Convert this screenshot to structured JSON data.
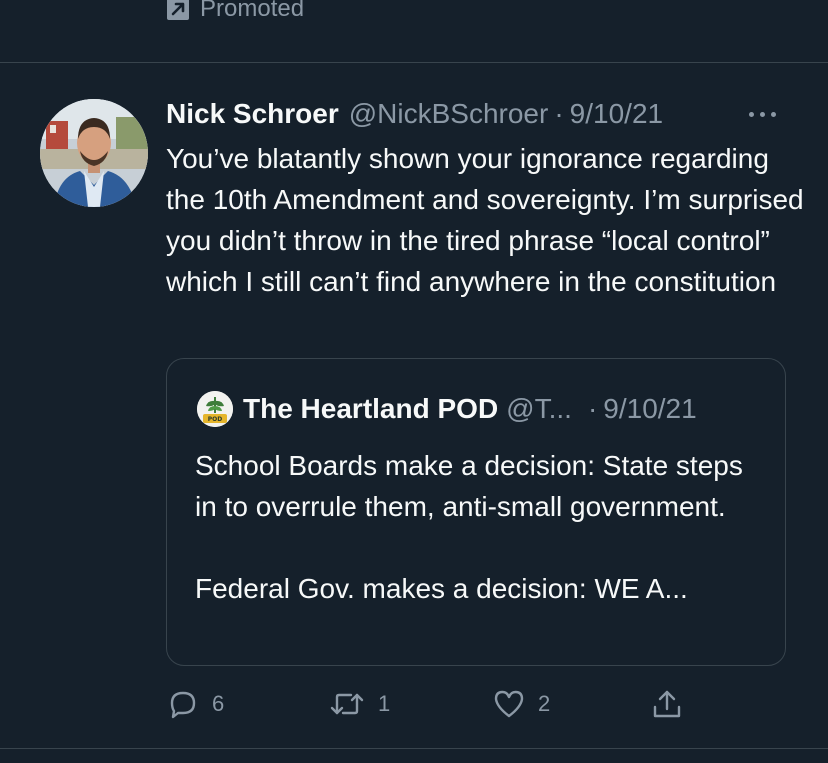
{
  "promoted": {
    "label": "Promoted",
    "icon": "promoted-arrow-icon"
  },
  "tweet": {
    "author_name": "Nick Schroer",
    "author_handle": "@NickBSchroer",
    "separator": "·",
    "date": "9/10/21",
    "text": "You’ve blatantly shown your ignorance regarding the 10th Amendment and sovereignty. I’m surprised you didn’t throw in the tired phrase “local control” which I still can’t find anywhere in the constitution",
    "more_icon": "more-horizontal-icon"
  },
  "quote": {
    "author_name": "The Heartland POD",
    "author_handle": "@T...",
    "separator": "·",
    "date": "9/10/21",
    "logo_text": "HEARTLAND POD",
    "text_line1": "School Boards make a decision: State steps in to overrule them, anti-small government.",
    "text_line2": "Federal Gov. makes a decision: WE A..."
  },
  "actions": {
    "reply_count": "6",
    "retweet_count": "1",
    "like_count": "2",
    "icons": [
      "reply-icon",
      "retweet-icon",
      "like-icon",
      "share-icon"
    ]
  },
  "colors": {
    "background": "#15202b",
    "text_primary": "#f7f9f9",
    "text_secondary": "#8b98a5",
    "border": "#38444d"
  }
}
